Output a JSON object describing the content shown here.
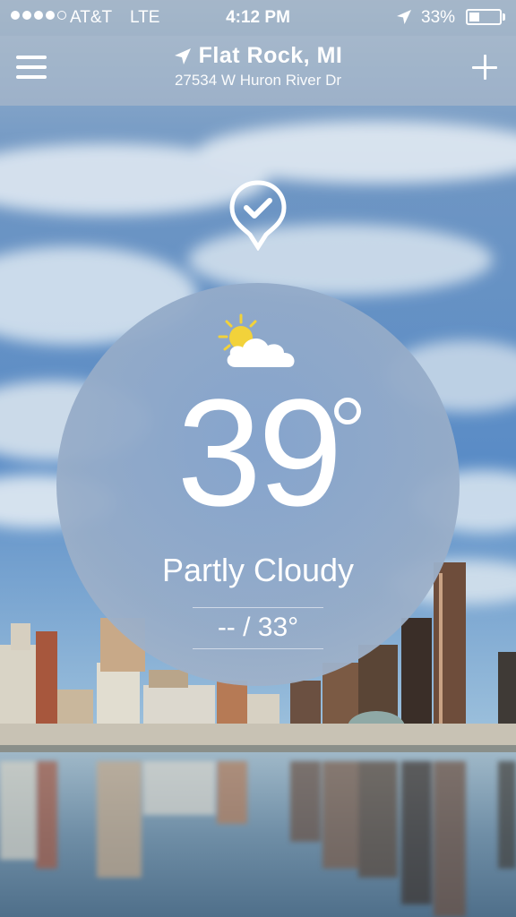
{
  "status_bar": {
    "carrier": "AT&T",
    "network": "LTE",
    "time": "4:12 PM",
    "battery": "33%",
    "battery_level": 0.33,
    "signal_bars": 4,
    "signal_total": 5
  },
  "header": {
    "city": "Flat Rock, MI",
    "address": "27534 W Huron River Dr",
    "menu_icon": "hamburger-icon",
    "add_icon": "plus-icon",
    "location_icon": "location-arrow-icon"
  },
  "weather": {
    "temperature": "39",
    "condition": "Partly Cloudy",
    "hi_lo": "-- / 33°",
    "icon": "partly-cloudy-icon"
  },
  "pin_icon": "checkmark-pin-icon",
  "colors": {
    "sky": "#5f8fc4",
    "sun": "#f2d23a",
    "circle": "#8fa9cb"
  }
}
